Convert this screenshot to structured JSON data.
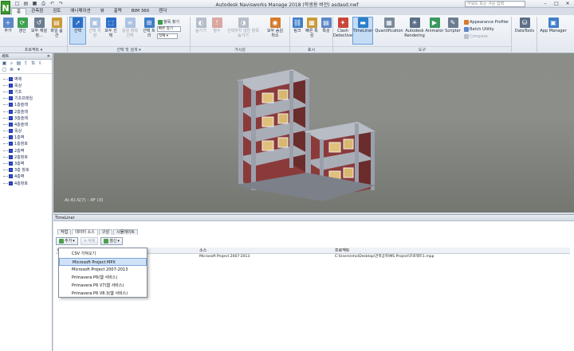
{
  "title_bar": {
    "title": "Autodesk Navisworks Manage 2018 (학생용 버전)   asdasd.nwf",
    "search_placeholder": "키워드 또는 구문 입력",
    "logo": "N"
  },
  "ribbon_tabs": [
    "홈",
    "관측점",
    "검토",
    "애니메이션",
    "뷰",
    "출력",
    "BIM 360",
    "렌더"
  ],
  "ribbon": {
    "project": {
      "buttons": [
        "추가",
        "갱신",
        "모두 재설정...",
        "파일 옵션"
      ],
      "label": "프로젝트 ▾"
    },
    "select": {
      "buttons": [
        "선택",
        "선택 저장",
        "모두 선택",
        "동일 항목 선택",
        "선택 트리"
      ],
      "find_label": "항목 찾기",
      "mode_value": "빠른 찾기",
      "mode_select": "첫째 ▾",
      "label": "선택 및 검색 ▾"
    },
    "visibility": {
      "buttons": [
        "숨기기",
        "필수",
        "선택하지 않은 항목 숨기기",
        "모두 숨김 취소"
      ],
      "label": "가시성"
    },
    "display": {
      "buttons": [
        "링크",
        "빠른 특성",
        "특성"
      ],
      "label": "표시"
    },
    "tools": {
      "buttons": [
        "Clash Detective",
        "TimeLiner",
        "Quantification",
        "Autodesk Rendering",
        "Animator",
        "Scripter"
      ],
      "small": [
        "Appearance Profiler",
        "Batch Utility",
        "Compare"
      ],
      "label": "도구"
    },
    "datatools": "DataTools",
    "appmanager": "App Manager"
  },
  "selection_tree": {
    "title": "세트",
    "items": [
      "벽체",
      "옥상",
      "기초",
      "기초프레임",
      "1층슬래",
      "2층슬래",
      "3층슬래",
      "4층슬래",
      "옥상",
      "1층벽",
      "1층창호",
      "2층벽",
      "2층창호",
      "3층벽",
      "3층 창호",
      "4층벽",
      "4층창호"
    ]
  },
  "viewport": {
    "label": "A(-6)-S(7) : 4F (3)"
  },
  "timeliner": {
    "title": "TimeLiner",
    "tabs": [
      "작업",
      "데이터 소스",
      "구성",
      "시뮬레이트"
    ],
    "toolbar": {
      "add": "추가",
      "delete": "삭제",
      "refresh": "갱신"
    },
    "columns": [
      "이름",
      "소스",
      "프로젝트"
    ],
    "rows": [
      {
        "name": "",
        "source": "Microsoft Project 2007-2013",
        "project": "C:\\Users\\nho\\Desktop\\건축공학\\MS Project\\프로젝트1.mpp"
      }
    ]
  },
  "add_dropdown": {
    "items": [
      "CSV 가져오기",
      "Microsoft Project MPX",
      "Microsoft Project 2007-2013",
      "Primavera P6(웹 서비스)",
      "Primavera P6 V7(웹 서비스)",
      "Primavera P6 V8.3(웹 서비스)"
    ],
    "highlighted": "Microsoft Project MPX"
  }
}
